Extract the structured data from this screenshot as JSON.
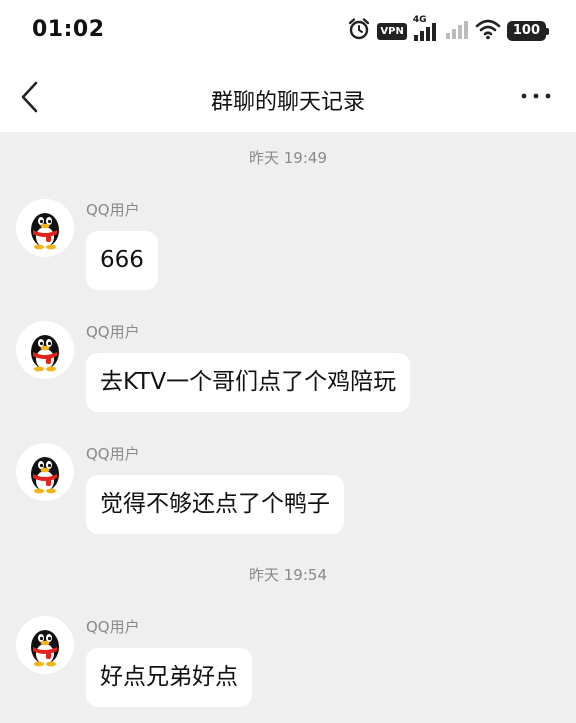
{
  "status_bar": {
    "time": "01:02",
    "vpn_label": "VPN",
    "network_label": "4G",
    "battery": "100"
  },
  "nav": {
    "title": "群聊的聊天记录",
    "back_icon": "chevron-left-icon",
    "more_icon": "more-horizontal-icon"
  },
  "messages": [
    {
      "sender": "QQ用户",
      "text": "666"
    },
    {
      "sender": "QQ用户",
      "text": "去KTV一个哥们点了个鸡陪玩"
    },
    {
      "sender": "QQ用户",
      "text": "觉得不够还点了个鸭子"
    },
    {
      "sender": "QQ用户",
      "text": "好点兄弟好点"
    }
  ],
  "timestamps": [
    "昨天 19:49",
    "昨天 19:54"
  ]
}
